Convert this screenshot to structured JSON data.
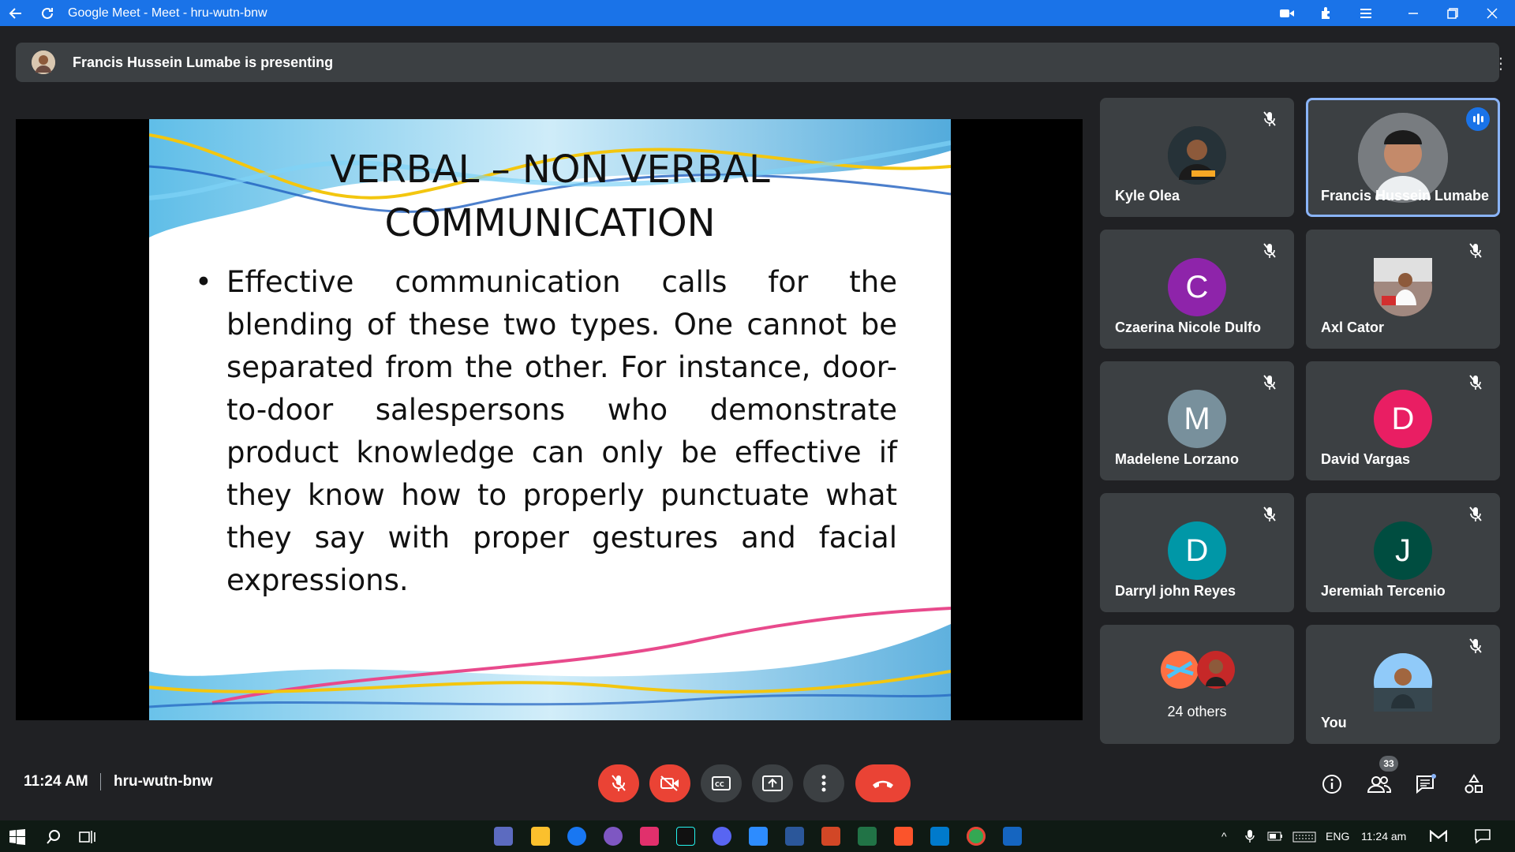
{
  "window": {
    "title": "Google Meet - Meet - hru-wutn-bnw"
  },
  "banner": {
    "text": "Francis Hussein Lumabe is presenting"
  },
  "slide": {
    "title_line1": "VERBAL – NON VERBAL",
    "title_line2": "COMMUNICATION",
    "bullet": "•",
    "body": "Effective communication calls for the blending of these two types. One cannot be separated from the other. For instance, door-to-door salespersons who demonstrate product knowledge can only be effective if they know how to properly punctuate what they say with proper gestures and facial expressions."
  },
  "participants": [
    {
      "name": "Kyle Olea",
      "initial": "",
      "color": "#2b2b2b",
      "muted": true
    },
    {
      "name": "Francis Hussein Lumabe",
      "initial": "",
      "color": "#5f6368",
      "speaking": true
    },
    {
      "name": "Czaerina Nicole Dulfo",
      "initial": "C",
      "color": "#8e24aa",
      "muted": true
    },
    {
      "name": "Axl Cator",
      "initial": "",
      "color": "#6d4c41",
      "muted": true
    },
    {
      "name": "Madelene Lorzano",
      "initial": "M",
      "color": "#78909c",
      "muted": true
    },
    {
      "name": "David Vargas",
      "initial": "D",
      "color": "#e91e63",
      "muted": true
    },
    {
      "name": "Darryl john Reyes",
      "initial": "D",
      "color": "#0097a7",
      "muted": true
    },
    {
      "name": "Jeremiah Tercenio",
      "initial": "J",
      "color": "#004d40",
      "muted": true
    },
    {
      "name": "24 others",
      "initial": "",
      "color": "#3c4043"
    },
    {
      "name": "You",
      "initial": "",
      "color": "#546e7a",
      "muted": true
    }
  ],
  "bottom": {
    "time": "11:24 AM",
    "meeting_code": "hru-wutn-bnw",
    "people_count": "33"
  },
  "taskbar": {
    "lang": "ENG",
    "clock": "11:24 am"
  },
  "colors": {
    "meet_bg": "#202124",
    "tile_bg": "#3c4043",
    "red": "#ea4335",
    "blue": "#1a73e8"
  }
}
